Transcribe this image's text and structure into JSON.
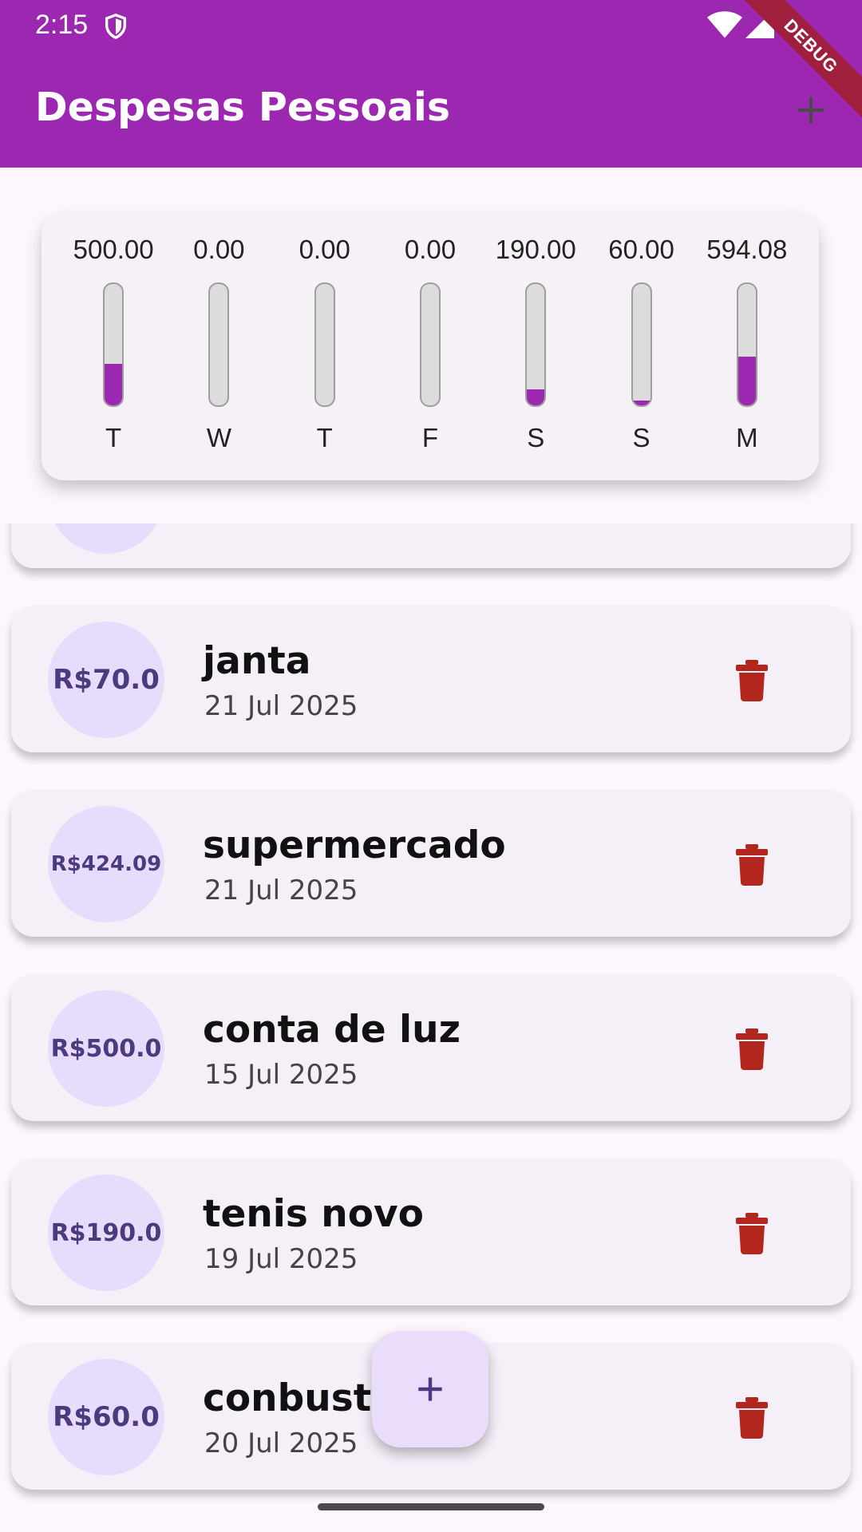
{
  "status_bar": {
    "time": "2:15"
  },
  "debug_banner": "DEBUG",
  "app_bar": {
    "title": "Despesas Pessoais",
    "action_icon": "add-icon"
  },
  "colors": {
    "primary": "#9c27b0",
    "amount_circle": "#e8dcfc",
    "delete": "#b3261e",
    "fab": "#eadcfb"
  },
  "chart": {
    "bars": [
      {
        "value": "500.00",
        "day": "T",
        "fraction": 0.34
      },
      {
        "value": "0.00",
        "day": "W",
        "fraction": 0
      },
      {
        "value": "0.00",
        "day": "T",
        "fraction": 0
      },
      {
        "value": "0.00",
        "day": "F",
        "fraction": 0
      },
      {
        "value": "190.00",
        "day": "S",
        "fraction": 0.13
      },
      {
        "value": "60.00",
        "day": "S",
        "fraction": 0.04
      },
      {
        "value": "594.08",
        "day": "M",
        "fraction": 0.4
      }
    ]
  },
  "transactions": [
    {
      "amount": "",
      "title": "",
      "date": ""
    },
    {
      "amount": "R$70.0",
      "title": "janta",
      "date": "21 Jul 2025"
    },
    {
      "amount": "R$424.09",
      "title": "supermercado",
      "date": "21 Jul 2025"
    },
    {
      "amount": "R$500.0",
      "title": "conta de luz",
      "date": "15 Jul 2025"
    },
    {
      "amount": "R$190.0",
      "title": "tenis novo",
      "date": "19 Jul 2025"
    },
    {
      "amount": "R$60.0",
      "title": "conbustiv",
      "date": "20 Jul 2025"
    }
  ],
  "fab": {
    "icon": "add-icon"
  }
}
